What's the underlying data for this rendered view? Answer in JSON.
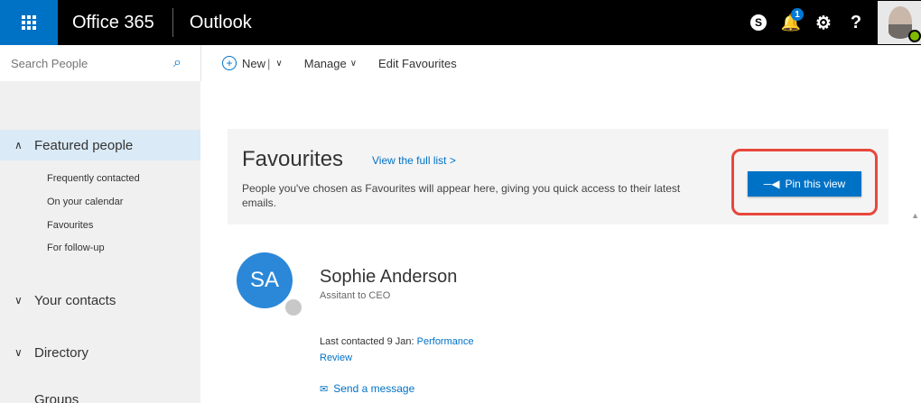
{
  "header": {
    "brand": "Office 365",
    "app": "Outlook",
    "icons": [
      "waffle-icon",
      "skype-icon",
      "bell-icon",
      "gear-icon",
      "help-icon"
    ],
    "notification_count": "1",
    "skype_glyph": "S",
    "help_glyph": "?"
  },
  "search": {
    "placeholder": "Search People"
  },
  "toolbar": {
    "new_label": "New",
    "manage_label": "Manage",
    "edit_favourites_label": "Edit Favourites"
  },
  "sidebar": {
    "featured_label": "Featured people",
    "featured_items": [
      {
        "label": "Frequently contacted"
      },
      {
        "label": "On your calendar"
      },
      {
        "label": "Favourites"
      },
      {
        "label": "For follow-up"
      }
    ],
    "your_contacts_label": "Your contacts",
    "directory_label": "Directory",
    "groups_label": "Groups"
  },
  "favourites": {
    "title": "Favourites",
    "view_link": "View the full list >",
    "description": "People you've chosen as Favourites will appear here, giving you quick access to their latest emails.",
    "pin_label": "Pin this view"
  },
  "contact": {
    "initials": "SA",
    "name": "Sophie Anderson",
    "title": "Assitant to CEO",
    "last_contacted_prefix": "Last contacted 9 Jan: ",
    "last_contacted_link": "Performance Review",
    "send_message": "Send a message"
  },
  "colors": {
    "brand_blue": "#0072c6",
    "highlight_red": "#e8473c",
    "avatar_blue": "#2b88d8"
  }
}
